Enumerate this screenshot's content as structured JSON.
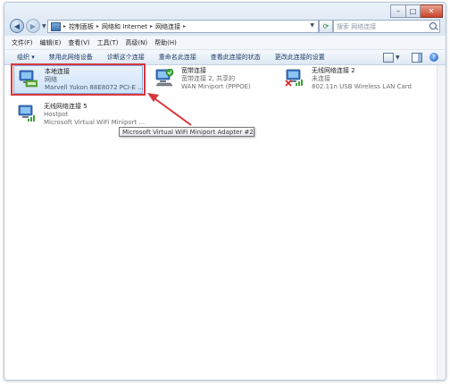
{
  "address": {
    "crumbs": [
      "控制面板",
      "网络和 Internet",
      "网络连接"
    ],
    "search_placeholder": "搜索 网络连接"
  },
  "window_controls": {
    "minimize": "–",
    "maximize": "□",
    "close": "✕"
  },
  "menu": [
    "文件(F)",
    "编辑(E)",
    "查看(V)",
    "工具(T)",
    "高级(N)",
    "帮助(H)"
  ],
  "toolbar": {
    "organize": "组织 ▾",
    "items": [
      "禁用此网络设备",
      "诊断这个连接",
      "重命名此连接",
      "查看此连接的状态",
      "更改此连接的设置"
    ]
  },
  "connections": [
    {
      "name": "本地连接",
      "status": "网络",
      "device": "Marvell Yukon 88E8072 PCI-E ..."
    },
    {
      "name": "宽带连接",
      "status": "宽带连接 2, 共享的",
      "device": "WAN Miniport (PPPOE)"
    },
    {
      "name": "无线网络连接 2",
      "status": "未连接",
      "device": "802.11n USB Wireless LAN Card"
    },
    {
      "name": "无线网络连接 5",
      "status": "Hostpot",
      "device": "Microsoft Virtual WiFi Miniport ..."
    }
  ],
  "tooltip": "Microsoft Virtual WiFi Miniport Adapter #2",
  "colors": {
    "highlight": "#d9363e",
    "accent": "#84acdd"
  },
  "icons": {
    "network": "network-adapter-icon",
    "connected_badge": "green-check-icon",
    "disconnected_badge": "red-x-icon"
  }
}
